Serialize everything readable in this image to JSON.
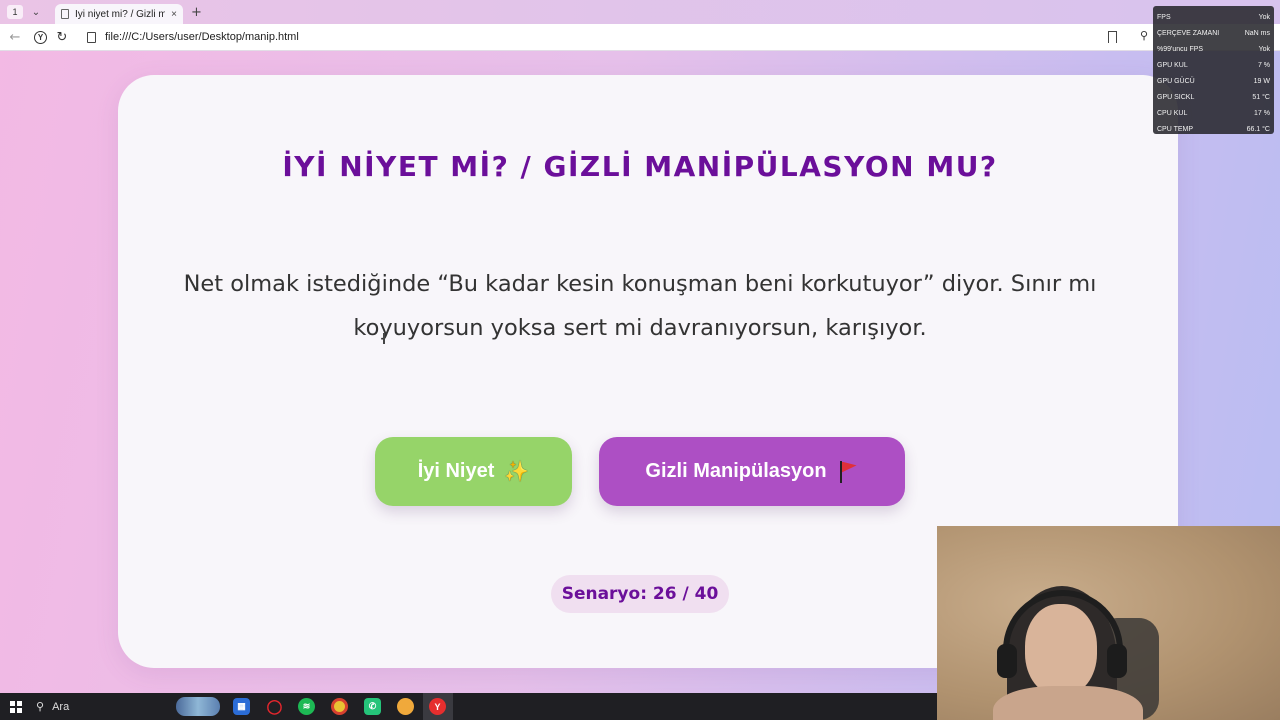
{
  "browser": {
    "tab_count": "1",
    "tab_title": "İyi niyet mi? / Gizli mani",
    "tab_close": "×",
    "new_tab": "+",
    "tab_list": "⌄",
    "url": "file:///C:/Users/user/Desktop/manip.html",
    "back": "←",
    "reload": "↻"
  },
  "card": {
    "title": "İYİ NİYET Mİ? / GİZLİ MANİPÜLASYON MU?",
    "scenario": "Net olmak istediğinde “Bu kadar kesin konuşman beni korkutuyor” diyor. Sınır mı koyuyorsun yoksa sert mi davranıyorsun, karışıyor.",
    "good_button": "İyi Niyet",
    "good_emoji": "✨",
    "bad_button": "Gizli Manipülasyon",
    "counter": "Senaryo: 26 / 40"
  },
  "perf_overlay": {
    "rows": [
      {
        "label": "FPS",
        "value": "Yok"
      },
      {
        "label": "ÇERÇEVE ZAMANI",
        "value": "NaN ms"
      },
      {
        "label": "%99'uncu FPS",
        "value": "Yok"
      },
      {
        "label": "GPU KUL",
        "value": "7 %"
      },
      {
        "label": "GPU GÜCÜ",
        "value": "19 W"
      },
      {
        "label": "GPU SICKL",
        "value": "51 °C"
      },
      {
        "label": "CPU KUL",
        "value": "17 %"
      },
      {
        "label": "CPU TEMP",
        "value": "66.1 °C"
      }
    ]
  },
  "taskbar": {
    "search_label": "Ara",
    "apps": [
      "opera-icon",
      "spotify-icon",
      "chrome-icon",
      "whatsapp-icon",
      "chrome-badge-icon",
      "yandex-icon"
    ]
  },
  "colors": {
    "title": "#6b0f9a",
    "good_button": "#96d469",
    "bad_button": "#ad4fc4",
    "counter_bg": "#f0dff0"
  }
}
